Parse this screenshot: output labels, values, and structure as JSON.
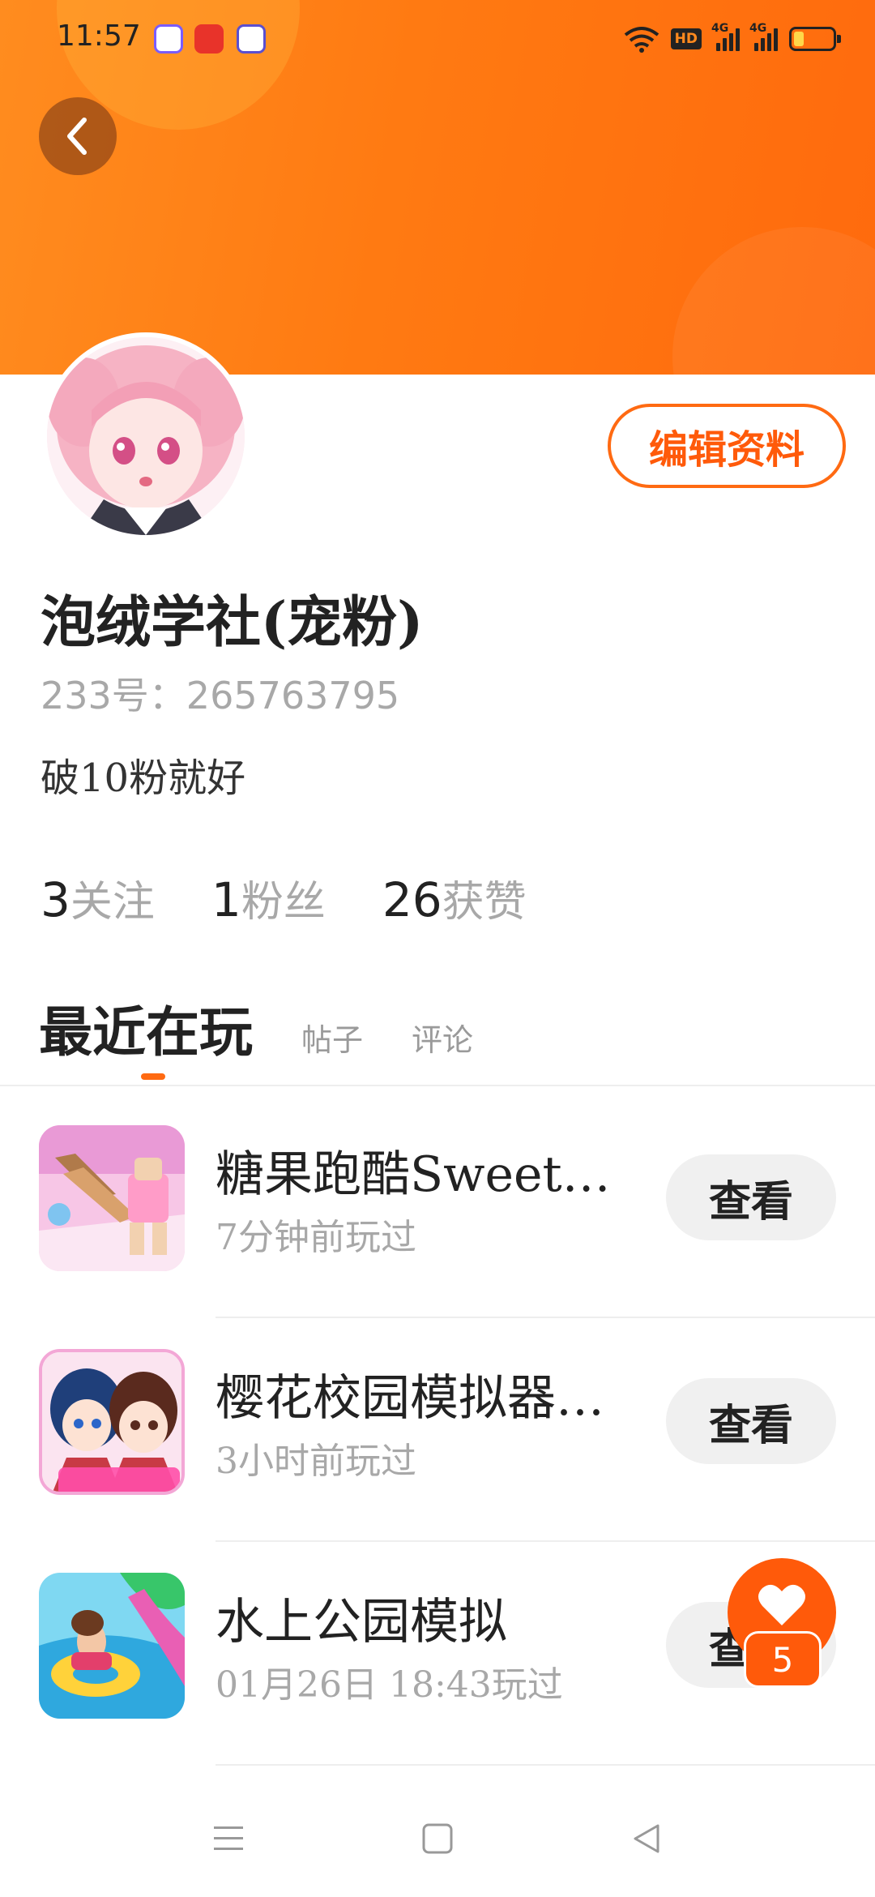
{
  "status_bar": {
    "time": "11:57",
    "hd_label": "HD",
    "network_1": "4G",
    "network_2": "4G",
    "battery_level": 0.25
  },
  "header": {
    "back_icon": "chevron-left-icon"
  },
  "profile": {
    "edit_button": "编辑资料",
    "name": "泡绒学社(宠粉)",
    "id_text": "233号：265763795",
    "bio": "破10粉就好",
    "stats": [
      {
        "num": "3",
        "label": "关注"
      },
      {
        "num": "1",
        "label": "粉丝"
      },
      {
        "num": "26",
        "label": "获赞"
      }
    ]
  },
  "tabs": {
    "active": "最近在玩",
    "items": [
      "帖子",
      "评论"
    ]
  },
  "games": [
    {
      "title": "糖果跑酷Sweet…",
      "time": "7分钟前玩过",
      "button": "查看"
    },
    {
      "title": "樱花校园模拟器…",
      "time": "3小时前玩过",
      "button": "查看"
    },
    {
      "title": "水上公园模拟",
      "time": "01月26日  18:43玩过",
      "button": "查看"
    }
  ],
  "floating_like": {
    "count": "5",
    "icon": "heart-icon"
  },
  "nav_bar": {
    "icons": [
      "menu-icon",
      "home-square-icon",
      "back-triangle-icon"
    ]
  },
  "colors": {
    "accent": "#ff6a12",
    "header_gradient_start": "#ff8c1f",
    "header_gradient_end": "#ff6a0d"
  }
}
